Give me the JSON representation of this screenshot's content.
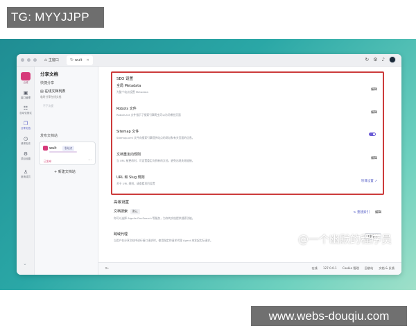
{
  "overlay": {
    "tg_label": "TG: MYYJJPP",
    "watermark": "@一个幽默的程序员",
    "url": "www.webs-douqiu.com"
  },
  "colors": {
    "highlight_border": "#cc3b3b",
    "accent": "#5a63c8",
    "brand": "#d63a7a",
    "toggle_on": "#6a5bd6",
    "stage_gradient_start": "#1f8d93",
    "stage_gradient_end": "#9fe0c9"
  },
  "titlebar": {
    "tabs": [
      {
        "label": "主窗口",
        "icon": "home-icon"
      },
      {
        "label": "wult",
        "icon": "refresh-icon"
      }
    ]
  },
  "rail": {
    "logo_label": "山城",
    "items": [
      {
        "label": "接口管理",
        "icon": "api-icon"
      },
      {
        "label": "自动化测试",
        "icon": "test-icon"
      },
      {
        "label": "分享文档",
        "icon": "share-doc-icon"
      },
      {
        "label": "请求历史",
        "icon": "history-icon"
      },
      {
        "label": "项目设置",
        "icon": "settings-icon"
      },
      {
        "label": "邀请成员",
        "icon": "invite-icon"
      }
    ]
  },
  "sidebar": {
    "title": "分享文档",
    "quick_share_label": "快捷分享",
    "quick_item": {
      "title": "在线文档列表",
      "subtitle": "临时分享在线文档"
    },
    "muted_item": "不下次提",
    "publish_label": "发布文档站",
    "site_card": {
      "name": "wult",
      "badge": "发站点",
      "status": "已发布"
    },
    "add_site": "新建文档站"
  },
  "seo": {
    "title": "SEO 设置",
    "rows": [
      {
        "title": "全局 Metadata",
        "desc": "为整个站点设置 Metadata",
        "action": "编辑"
      },
      {
        "title": "Robots 文件",
        "desc": "Robots.txt 文件指示了搜索引擎爬虫可以访问哪些页面",
        "action": "编辑"
      },
      {
        "title": "Sitemap 文件",
        "desc": "Sitemap.xml 文件向搜索引擎提供站点的网址和有关页面的信息。"
      },
      {
        "title": "文档重定向规则",
        "desc": "当 URL 被更改时，可设置重定向到新的文档，避免出现失效链接。",
        "action": "编辑"
      },
      {
        "title": "URL 和 Slug 规则",
        "desc": "关于 URL 规则，请查看项目设置",
        "link": "项目设置 ↗"
      }
    ]
  },
  "advanced": {
    "title": "高级设置",
    "rows": [
      {
        "title": "文档搜索",
        "badge": "默认",
        "desc": "你可以选择 Algolia DocSearch 等服务，为你的文档提供搜索功能。",
        "actions": [
          "重建索引",
          "编辑"
        ]
      },
      {
        "title": "跨域代理",
        "desc": "当用户在分享文档中进行接口请求时，使用指定的请求代理 Agent 来发起实际请求。",
        "select": "自动"
      }
    ]
  },
  "statusbar": {
    "items": [
      "在线",
      "127.0.0.1",
      "Cookie 管理",
      "回收站",
      "文档 & 反馈"
    ]
  }
}
